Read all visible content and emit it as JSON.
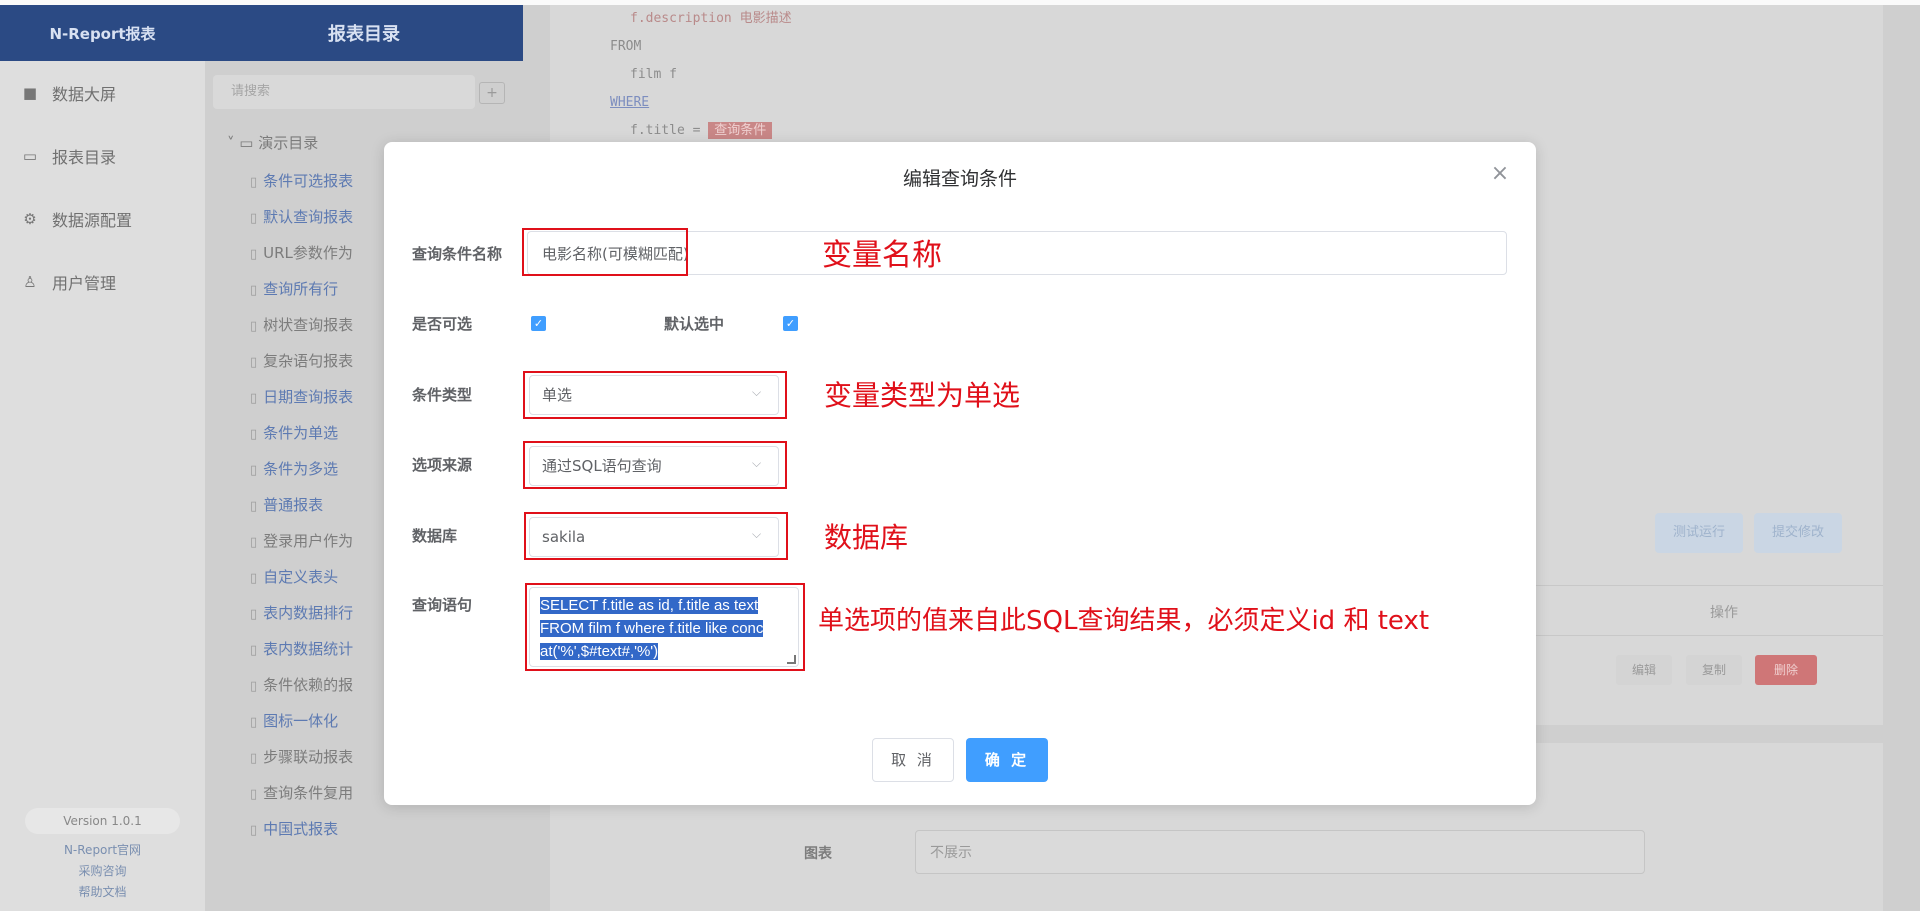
{
  "sidebar": {
    "brand": "N-Report报表",
    "items": [
      {
        "label": "数据大屏",
        "icon": "dashboard-icon"
      },
      {
        "label": "报表目录",
        "icon": "folder-icon"
      },
      {
        "label": "数据源配置",
        "icon": "gear-icon"
      },
      {
        "label": "用户管理",
        "icon": "user-icon"
      }
    ],
    "version": "Version 1.0.1",
    "links": [
      "N-Report官网",
      "采购咨询",
      "帮助文档"
    ]
  },
  "tree": {
    "header": "报表目录",
    "search_placeholder": "请搜索",
    "add_label": "+",
    "root_label": "演示目录",
    "items": [
      {
        "label": "条件可选报表",
        "style": "link"
      },
      {
        "label": "默认查询报表",
        "style": "link"
      },
      {
        "label": "URL参数作为",
        "style": "plain"
      },
      {
        "label": "查询所有行",
        "style": "link"
      },
      {
        "label": "树状查询报表",
        "style": "plain"
      },
      {
        "label": "复杂语句报表",
        "style": "plain"
      },
      {
        "label": "日期查询报表",
        "style": "link"
      },
      {
        "label": "条件为单选",
        "style": "link"
      },
      {
        "label": "条件为多选",
        "style": "link"
      },
      {
        "label": "普通报表",
        "style": "link"
      },
      {
        "label": "登录用户作为",
        "style": "plain"
      },
      {
        "label": "自定义表头",
        "style": "link"
      },
      {
        "label": "表内数据排行",
        "style": "link"
      },
      {
        "label": "表内数据统计",
        "style": "link"
      },
      {
        "label": "条件依赖的报",
        "style": "plain"
      },
      {
        "label": "图标一体化",
        "style": "link"
      },
      {
        "label": "步骤联动报表",
        "style": "plain"
      },
      {
        "label": "查询条件复用",
        "style": "plain"
      },
      {
        "label": "中国式报表",
        "style": "link"
      }
    ]
  },
  "background": {
    "code_lines": [
      "f.description 电影描述",
      "FROM",
      "film f",
      "WHERE",
      "f.title = "
    ],
    "code_token": "查询条件",
    "test_button": "测试运行",
    "submit_button": "提交修改",
    "ops_header": "操作",
    "row_btn_edit": "编辑",
    "row_btn_copy": "复制",
    "row_btn_delete": "删除",
    "bottom_label": "图表",
    "bottom_select": "不展示"
  },
  "modal": {
    "title": "编辑查询条件",
    "close_icon": "close-icon",
    "labels": {
      "name": "查询条件名称",
      "optional": "是否可选",
      "default_selected": "默认选中",
      "type": "条件类型",
      "source": "选项来源",
      "database": "数据库",
      "query": "查询语句"
    },
    "values": {
      "name": "电影名称(可模糊匹配)",
      "optional_checked": "✓",
      "default_checked": "✓",
      "type": "单选",
      "source": "通过SQL语句查询",
      "database": "sakila",
      "query_lines": [
        "SELECT  f.title as id, f.title  as text",
        "FROM film f where f.title like conc",
        "at('%',$#text#,'%')"
      ]
    },
    "buttons": {
      "cancel": "取 消",
      "confirm": "确 定"
    }
  },
  "annotations": {
    "var_name": "变量名称",
    "var_type": "变量类型为单选",
    "database": "数据库",
    "sql_note": "单选项的值来自此SQL查询结果，必须定义id 和 text",
    "color": "#e0101a"
  }
}
